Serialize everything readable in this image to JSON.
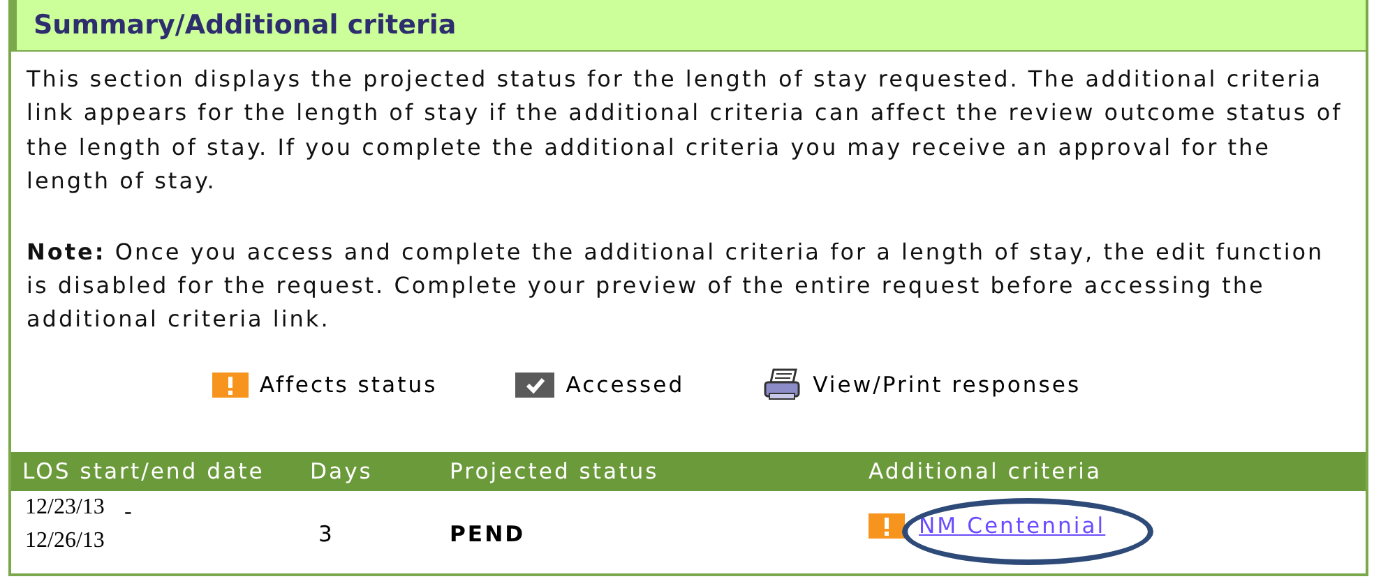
{
  "section": {
    "title": "Summary/Additional criteria"
  },
  "description": "This section displays the projected status for the length of stay requested. The additional criteria link appears for the length of stay if the additional criteria can affect the review outcome status of the length of stay. If you complete the additional criteria you may receive an approval for the length of stay.",
  "note": "**Note:** Once you access and complete the additional criteria for a length of stay, the edit function is disabled for the request. Complete your preview of the entire request before accessing the additional criteria link.",
  "legend": [
    {
      "kind": "affects",
      "label": "Affects status"
    },
    {
      "kind": "accessed",
      "label": "Accessed"
    },
    {
      "kind": "print",
      "label": "View/Print responses"
    }
  ],
  "table": {
    "columns": [
      "LOS start/end date",
      "Days",
      "Projected status",
      "Additional criteria"
    ],
    "rows": [
      {
        "start": "12/23/13",
        "separator": "-",
        "end": "12/26/13",
        "days": "3",
        "status": "PEND",
        "criteria": {
          "link": "NM Centennial",
          "affects_status": true,
          "circled": true
        }
      }
    ]
  }
}
